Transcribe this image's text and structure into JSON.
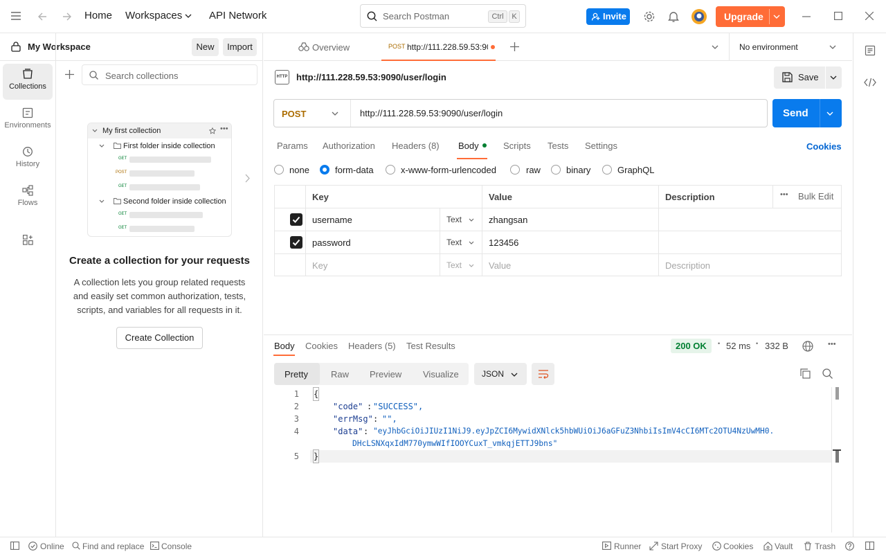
{
  "topbar": {
    "home": "Home",
    "workspaces": "Workspaces",
    "api_network": "API Network",
    "search_placeholder": "Search Postman",
    "kbd_ctrl": "Ctrl",
    "kbd_k": "K",
    "invite": "Invite",
    "upgrade": "Upgrade"
  },
  "workspace": {
    "name": "My Workspace",
    "new": "New",
    "import": "Import"
  },
  "iconbar": {
    "items": [
      {
        "label": "Collections",
        "icon": "collections-icon"
      },
      {
        "label": "Environments",
        "icon": "environments-icon"
      },
      {
        "label": "History",
        "icon": "history-icon"
      },
      {
        "label": "Flows",
        "icon": "flows-icon"
      }
    ]
  },
  "sidebar": {
    "search_placeholder": "Search collections",
    "preview": {
      "collection": "My first collection",
      "folder1": "First folder inside collection",
      "folder2": "Second folder inside collection",
      "m_get": "GET",
      "m_post": "POST"
    },
    "empty_title": "Create a collection for your requests",
    "empty_desc_1": "A collection lets you group related requests",
    "empty_desc_2": "and easily set common authorization, tests,",
    "empty_desc_3": "scripts, and variables for all requests in it.",
    "create_button": "Create Collection"
  },
  "tabs": {
    "overview": "Overview",
    "active_method": "POST",
    "active_url": "http://111.228.59.53:90",
    "environment": "No environment"
  },
  "request": {
    "badge": "HTTP",
    "title": "http://111.228.59.53:9090/user/login",
    "save": "Save",
    "method": "POST",
    "url": "http://111.228.59.53:9090/user/login",
    "send": "Send",
    "tabs": [
      "Params",
      "Authorization",
      "Headers (8)",
      "Body",
      "Scripts",
      "Tests",
      "Settings"
    ],
    "cookies": "Cookies",
    "body_types": [
      "none",
      "form-data",
      "x-www-form-urlencoded",
      "raw",
      "binary",
      "GraphQL"
    ],
    "selected_body": "form-data"
  },
  "form": {
    "headers": {
      "key": "Key",
      "value": "Value",
      "description": "Description",
      "bulk_edit": "Bulk Edit"
    },
    "rows": [
      {
        "key": "username",
        "type": "Text",
        "value": "zhangsan",
        "checked": true
      },
      {
        "key": "password",
        "type": "Text",
        "value": "123456",
        "checked": true
      }
    ],
    "placeholder": {
      "key": "Key",
      "type": "Text",
      "value": "Value",
      "description": "Description"
    }
  },
  "response": {
    "tabs": [
      "Body",
      "Cookies",
      "Headers (5)",
      "Test Results"
    ],
    "status": "200 OK",
    "time": "52 ms",
    "size": "332 B",
    "views": [
      "Pretty",
      "Raw",
      "Preview",
      "Visualize"
    ],
    "format": "JSON",
    "lines": [
      {
        "n": "1",
        "text": "{"
      },
      {
        "n": "2",
        "key": "\"code\"",
        "val": "\"SUCCESS\","
      },
      {
        "n": "3",
        "key": "\"errMsg\"",
        "val": "\"\","
      },
      {
        "n": "4",
        "key": "\"data\"",
        "val": "\"eyJhbGciOiJIUzI1NiJ9.eyJpZCI6MywidXNlck5hbWUiOiJ6aGFuZ3NhbiIsImV4cCI6MTc2OTU4NzUwMH0.",
        "cont": "DHcLSNXqxIdM770ymwWIfIOOYCuxT_vmkqjETTJ9bns\""
      },
      {
        "n": "5",
        "text": "}"
      }
    ]
  },
  "statusbar": {
    "online": "Online",
    "find": "Find and replace",
    "console": "Console",
    "runner": "Runner",
    "proxy": "Start Proxy",
    "cookies": "Cookies",
    "vault": "Vault",
    "trash": "Trash"
  },
  "colors": {
    "accent": "#097bed",
    "upgrade": "#ff6c37",
    "success": "#007f31"
  }
}
